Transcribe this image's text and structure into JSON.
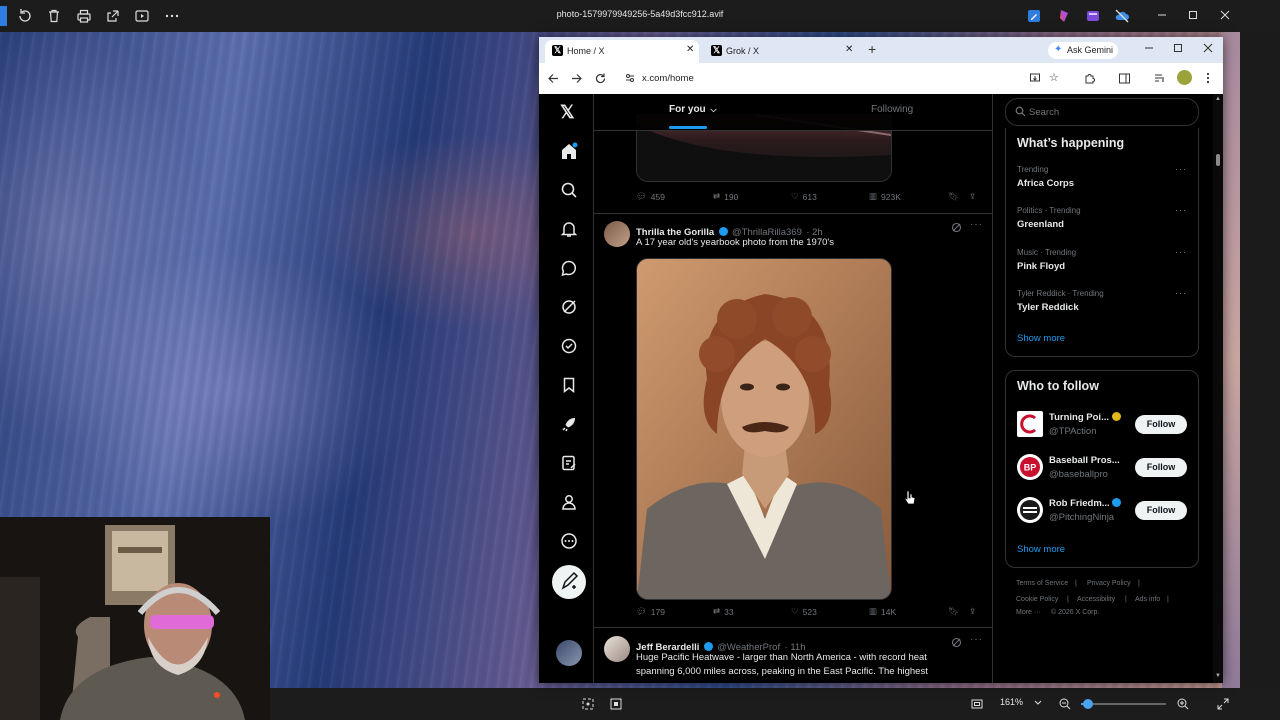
{
  "viewer": {
    "filename": "photo-1579979949256-5a49d3fcc912.avif",
    "zoom": "161%",
    "zoom_level": 0.08
  },
  "browser": {
    "tabs": [
      {
        "label": "Home / X",
        "active": true
      },
      {
        "label": "Grok / X",
        "active": false
      }
    ],
    "ask_gemini": "Ask Gemini",
    "url": "x.com/home"
  },
  "feed": {
    "tabs": [
      {
        "label": "For you",
        "active": true
      },
      {
        "label": "Following",
        "active": false
      }
    ],
    "prev_tweet_stats": {
      "replies": "459",
      "reposts": "190",
      "likes": "613",
      "views": "923K"
    },
    "tweets": [
      {
        "name": "Thrilla the Gorilla",
        "handle": "@ThrillaRilla369",
        "time": "· 2h",
        "text": "A 17 year old's yearbook photo from the 1970's",
        "replies": "179",
        "reposts": "33",
        "likes": "523",
        "views": "14K"
      },
      {
        "name": "Jeff Berardelli",
        "handle": "@WeatherProf",
        "time": "· 11h",
        "text_line1": "Huge Pacific Heatwave - larger than North America - with record heat",
        "text_line2": "spanning 6,000 miles across, peaking in the East Pacific. The highest"
      }
    ]
  },
  "sidebar": {
    "search_placeholder": "Search",
    "whats_happening": {
      "title": "What’s happening",
      "trends": [
        {
          "meta": "Trending",
          "name": "Africa Corps"
        },
        {
          "meta": "Politics · Trending",
          "name": "Greenland"
        },
        {
          "meta": "Music · Trending",
          "name": "Pink Floyd"
        },
        {
          "meta": "Tyler Reddick · Trending",
          "name": "Tyler Reddick"
        }
      ],
      "show_more": "Show more"
    },
    "who_to_follow": {
      "title": "Who to follow",
      "accounts": [
        {
          "name": "Turning Poi...",
          "handle": "@TPAction",
          "badge": "#e2b719"
        },
        {
          "name": "Baseball Pros...",
          "handle": "@baseballpro",
          "badge": ""
        },
        {
          "name": "Rob Friedm...",
          "handle": "@PitchingNinja",
          "badge": "#1d9bf0"
        }
      ],
      "follow_label": "Follow",
      "show_more": "Show more"
    },
    "footer": {
      "terms": "Terms of Service",
      "privacy": "Privacy Policy",
      "cookie": "Cookie Policy",
      "accessibility": "Accessibility",
      "ads": "Ads info",
      "more": "More ···",
      "copyright": "© 2026 X Corp."
    }
  },
  "colors": {
    "accent": "#1d9bf0",
    "verified": "#1d9bf0",
    "gold": "#e2b719"
  }
}
